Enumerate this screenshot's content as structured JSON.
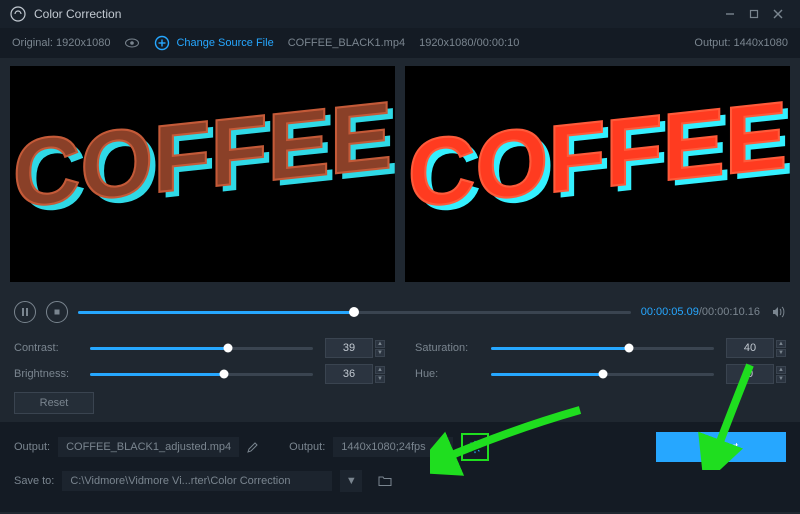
{
  "title": "Color Correction",
  "info": {
    "original_label": "Original: 1920x1080",
    "change_source": "Change Source File",
    "filename": "COFFEE_BLACK1.mp4",
    "resolution_time": "1920x1080/00:00:10",
    "output_label": "Output: 1440x1080"
  },
  "preview_word": "COFFEE",
  "timeline": {
    "current": "00:00:05.09",
    "total": "/00:00:10.16",
    "progress_pct": 50
  },
  "sliders": {
    "contrast": {
      "label": "Contrast:",
      "value": "39",
      "pct": 62
    },
    "brightness": {
      "label": "Brightness:",
      "value": "36",
      "pct": 60
    },
    "saturation": {
      "label": "Saturation:",
      "value": "40",
      "pct": 62
    },
    "hue": {
      "label": "Hue:",
      "value": "0",
      "pct": 50
    }
  },
  "reset_label": "Reset",
  "output": {
    "name_label": "Output:",
    "name_value": "COFFEE_BLACK1_adjusted.mp4",
    "fmt_label": "Output:",
    "fmt_value": "1440x1080;24fps"
  },
  "saveto": {
    "label": "Save to:",
    "value": "C:\\Vidmore\\Vidmore Vi...rter\\Color Correction"
  },
  "export_label": "Export"
}
